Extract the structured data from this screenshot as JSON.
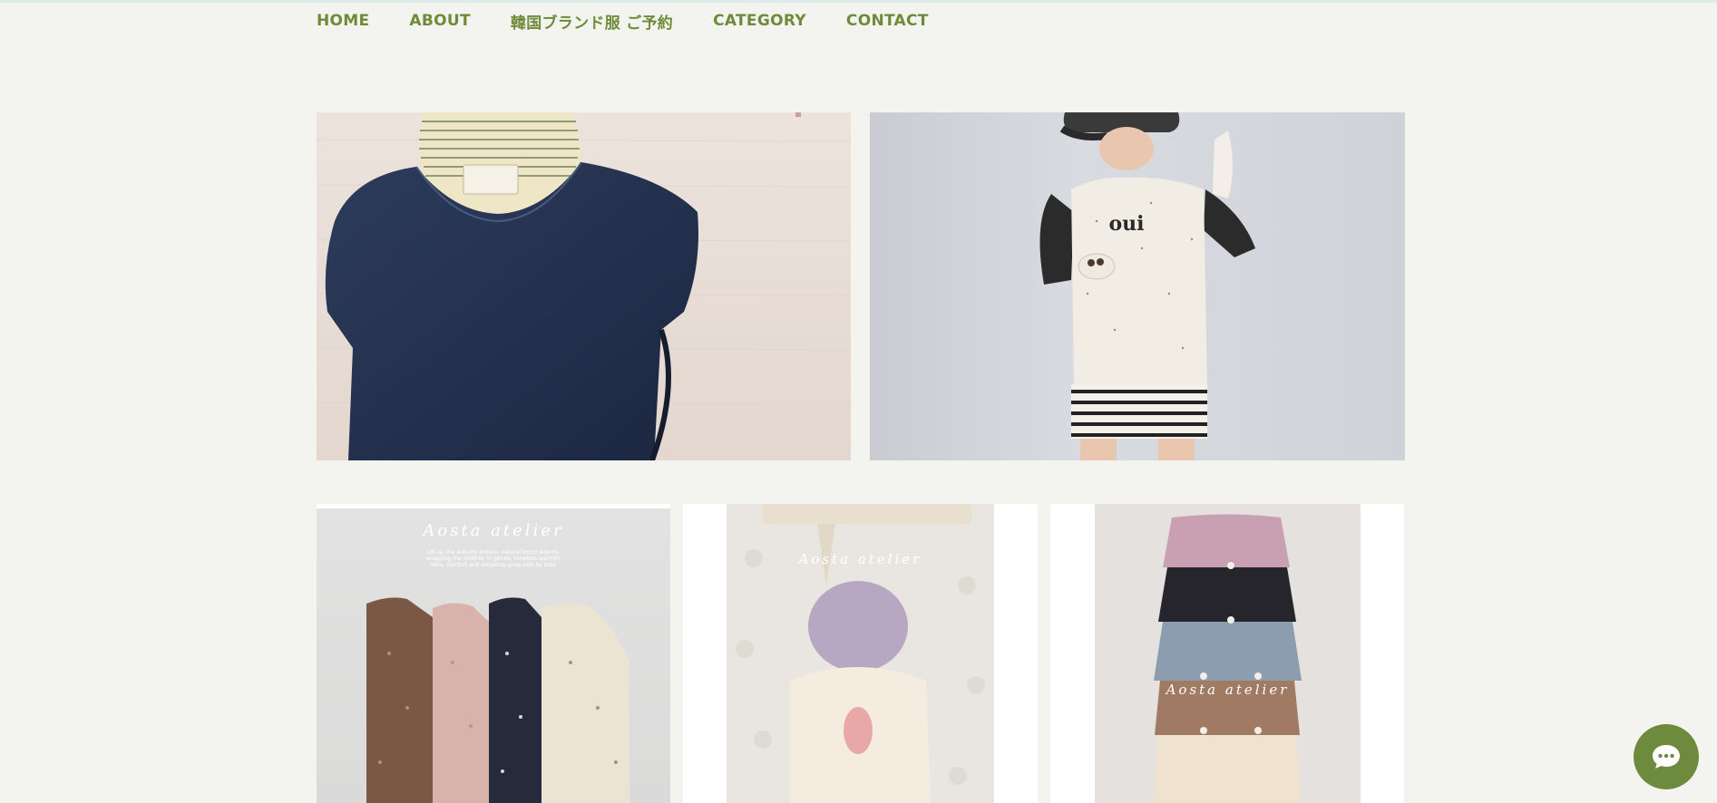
{
  "nav": {
    "items": [
      {
        "label": "HOME"
      },
      {
        "label": "ABOUT"
      },
      {
        "label": "韓国ブランド服 ご予約"
      },
      {
        "label": "CATEGORY"
      },
      {
        "label": "CONTACT"
      }
    ]
  },
  "photos": {
    "kid_shirt_text": "oui"
  },
  "products": [
    {
      "brand": "Aosta atelier",
      "brand_sub": "Lift up the autumn breeze, natural touch adorns, wrapping the children in gentle, timeless warmth. Here, comfort and elegance grow side by side."
    },
    {
      "brand": "Aosta atelier"
    },
    {
      "brand": "Aosta atelier"
    }
  ],
  "colors": {
    "accent": "#6f8b3a",
    "background": "#f3f4ef",
    "chat_button": "#6e8b3d"
  },
  "icons": {
    "chat": "chat-bubble-icon"
  }
}
